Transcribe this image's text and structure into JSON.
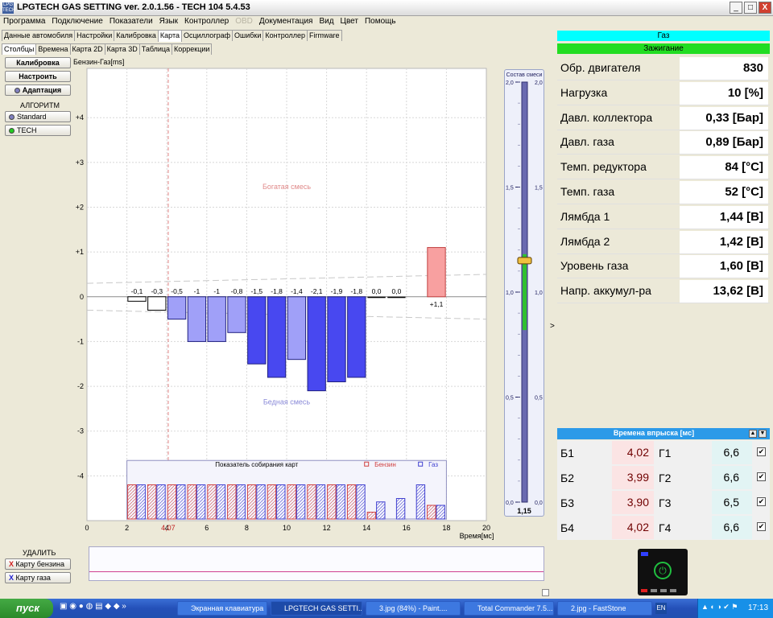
{
  "window": {
    "title": "LPGTECH GAS SETTING ver. 2.0.1.56  -  TECH 104   5.4.53",
    "icon_text": "LPG TECH",
    "minimize": "_",
    "maximize": "□",
    "close": "X"
  },
  "menu": [
    "Программа",
    "Подключение",
    "Показатели",
    "Язык",
    "Контроллер",
    "OBD",
    "Документация",
    "Вид",
    "Цвет",
    "Помощь"
  ],
  "tabs_main": [
    "Данные автомобиля",
    "Настройки",
    "Калибровка",
    "Карта",
    "Осциллограф",
    "Ошибки",
    "Контроллер",
    "Firmware"
  ],
  "tabs_main_active": "Карта",
  "tabs_sub": [
    "Столбцы",
    "Времена",
    "Карта 2D",
    "Карта 3D",
    "Таблица",
    "Коррекции"
  ],
  "tabs_sub_active": "Столбцы",
  "left_buttons": {
    "calibrate": "Калибровка",
    "tune": "Настроить",
    "adapt": "Адаптация"
  },
  "algorithm": {
    "title": "АЛГОРИТМ",
    "options": [
      "Standard",
      "TECH"
    ],
    "option_colors": [
      "#8080c0",
      "#22cc22"
    ]
  },
  "delete_section": {
    "title": "УДАЛИТЬ",
    "petrol": "Карту бензина",
    "gas": "Карту газа"
  },
  "chart_data": {
    "type": "bar",
    "title": "Бензин-Газ[ms]",
    "xlabel": "Время[мс]",
    "xlim": [
      0,
      20
    ],
    "ylim": [
      -5,
      5.1
    ],
    "xticks": [
      0,
      2,
      4,
      6,
      8,
      10,
      12,
      14,
      16,
      18,
      20
    ],
    "yticks": [
      -4,
      -3,
      -2,
      -1,
      0,
      1,
      2,
      3,
      4
    ],
    "ytick_labels": [
      "-4",
      "-3",
      "-2",
      "-1",
      "0",
      "+1",
      "+2",
      "+3",
      "+4"
    ],
    "grid": true,
    "marker_x": 4.07,
    "marker_label": "4,07",
    "rich_label": "Богатая смесь",
    "lean_label": "Бедная смесь",
    "bars": [
      {
        "x": 2.5,
        "value": -0.1,
        "label": "-0,1"
      },
      {
        "x": 3.5,
        "value": -0.3,
        "label": "-0,3"
      },
      {
        "x": 4.5,
        "value": -0.5,
        "label": "-0,5"
      },
      {
        "x": 5.5,
        "value": -1.0,
        "label": "-1"
      },
      {
        "x": 6.5,
        "value": -1.0,
        "label": "-1"
      },
      {
        "x": 7.5,
        "value": -0.8,
        "label": "-0,8"
      },
      {
        "x": 8.5,
        "value": -1.5,
        "label": "-1,5"
      },
      {
        "x": 9.5,
        "value": -1.8,
        "label": "-1,8"
      },
      {
        "x": 10.5,
        "value": -1.4,
        "label": "-1,4"
      },
      {
        "x": 11.5,
        "value": -2.1,
        "label": "-2,1"
      },
      {
        "x": 12.5,
        "value": -1.9,
        "label": "-1,9"
      },
      {
        "x": 13.5,
        "value": -1.8,
        "label": "-1,8"
      },
      {
        "x": 14.5,
        "value": 0.0,
        "label": "0,0"
      },
      {
        "x": 15.5,
        "value": 0.0,
        "label": "0,0"
      },
      {
        "x": 17.5,
        "value": 1.1,
        "label": "+1,1"
      }
    ],
    "collection": {
      "title": "Показатель собирания карт",
      "legend_petrol": "Бензин",
      "legend_gas": "Газ",
      "petrol": [
        1,
        1,
        1,
        1,
        1,
        1,
        1,
        1,
        1,
        1,
        1,
        1,
        0.2,
        0,
        0,
        0.4
      ],
      "gas": [
        1,
        1,
        1,
        1,
        1,
        1,
        1,
        1,
        1,
        1,
        1,
        1,
        0.5,
        0.6,
        1,
        0.4
      ]
    }
  },
  "mixture_scale": {
    "title": "Состав смеси",
    "ticks": [
      "2,0",
      "1,5",
      "1,0",
      "0,5",
      "0,0"
    ],
    "value": "1,15",
    "level": 1.15
  },
  "right_panel": {
    "mode": "Газ",
    "mode_color": "#00ffff",
    "ignition": "Зажигание",
    "ignition_color": "#22dd22",
    "params": [
      {
        "label": "Обр. двигателя",
        "value": "830"
      },
      {
        "label": "Нагрузка",
        "value": "10 [%]"
      },
      {
        "label": "Давл. коллектора",
        "value": "0,33 [Бар]"
      },
      {
        "label": "Давл. газа",
        "value": "0,89 [Бар]"
      },
      {
        "label": "Темп. редуктора",
        "value": "84 [°C]"
      },
      {
        "label": "Темп. газа",
        "value": "52 [°C]"
      },
      {
        "label": "Лямбда 1",
        "value": "1,44 [В]"
      },
      {
        "label": "Лямбда 2",
        "value": "1,42 [В]"
      },
      {
        "label": "Уровень газа",
        "value": "1,60 [В]"
      },
      {
        "label": "Напр. аккумул-ра",
        "value": "13,62 [В]"
      }
    ],
    "injection": {
      "title": "Времена впрыска [мс]",
      "rows": [
        {
          "b": "Б1",
          "bv": "4,02",
          "g": "Г1",
          "gv": "6,6"
        },
        {
          "b": "Б2",
          "bv": "3,99",
          "g": "Г2",
          "gv": "6,6"
        },
        {
          "b": "Б3",
          "bv": "3,90",
          "g": "Г3",
          "gv": "6,5"
        },
        {
          "b": "Б4",
          "bv": "4,02",
          "g": "Г4",
          "gv": "6,6"
        }
      ]
    },
    "collapse_arrow": ">"
  },
  "taskbar": {
    "start": "пуск",
    "tasks": [
      "Экранная клавиатура",
      "LPGTECH GAS SETTI...",
      "3.jpg (84%) - Paint....",
      "Total Commander 7.5...",
      "2.jpg - FastStone"
    ],
    "lang": "EN",
    "clock": "17:13"
  }
}
